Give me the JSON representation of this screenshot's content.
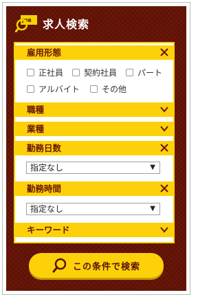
{
  "header": {
    "logo_text": "JOB",
    "title": "求人検索"
  },
  "sections": {
    "employment": {
      "label": "雇用形態",
      "options": [
        "正社員",
        "契約社員",
        "パート",
        "アルバイト",
        "その他"
      ]
    },
    "job_type": {
      "label": "職種"
    },
    "industry": {
      "label": "業種"
    },
    "work_days": {
      "label": "勤務日数",
      "select_value": "指定なし"
    },
    "work_hours": {
      "label": "勤務時間",
      "select_value": "指定なし"
    },
    "keyword": {
      "label": "キーワード"
    }
  },
  "search_button": {
    "label": "この条件で検索"
  },
  "colors": {
    "accent": "#fcd10a",
    "background": "#6b1608",
    "label": "#6b1608"
  }
}
